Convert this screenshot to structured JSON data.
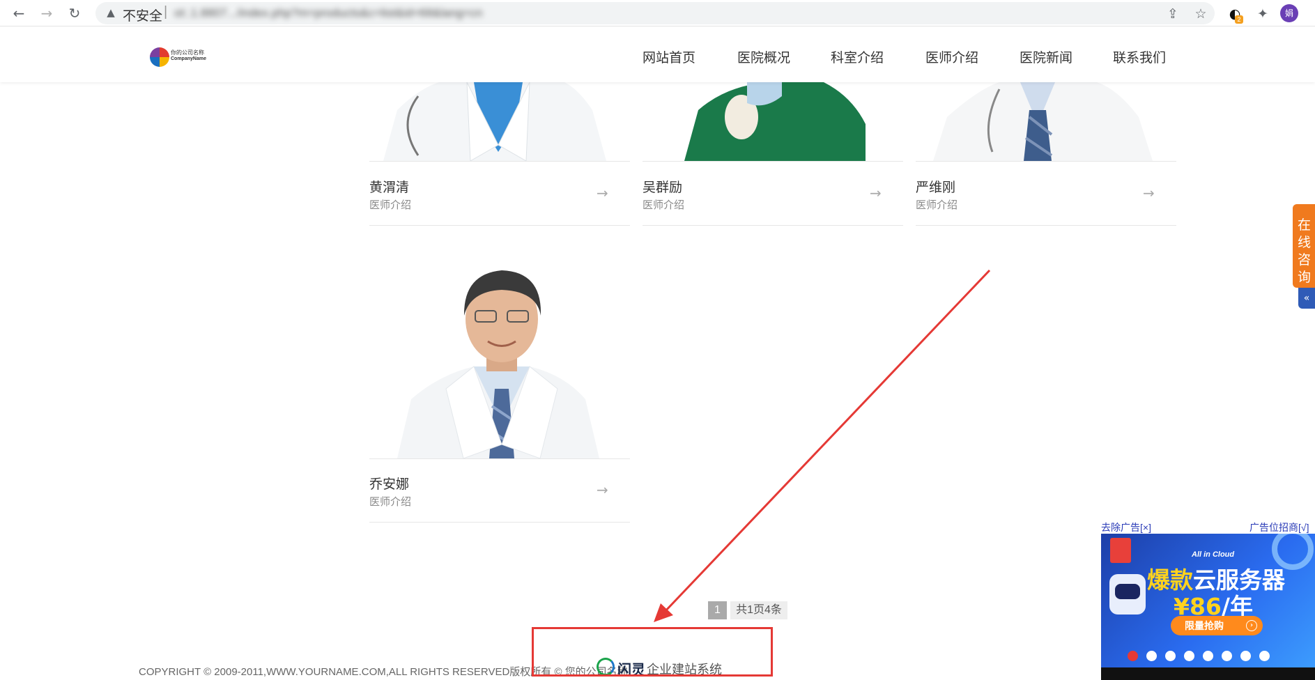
{
  "browser": {
    "security_label": "不安全",
    "url_blurred": "ot:.1.8807.../index.php?m=products&c=list&id=68&lang=cn",
    "ext_badge_count": "2",
    "profile_initial": "娟"
  },
  "header": {
    "logo_line1": "你的公司名称",
    "logo_line2": "CompanyName",
    "menu": [
      "网站首页",
      "医院概况",
      "科室介绍",
      "医师介绍",
      "医院新闻",
      "联系我们"
    ]
  },
  "doctors": [
    {
      "name": "黄渭清",
      "subtitle": "医师介绍"
    },
    {
      "name": "吴群励",
      "subtitle": "医师介绍"
    },
    {
      "name": "严维刚",
      "subtitle": "医师介绍"
    },
    {
      "name": "乔安娜",
      "subtitle": "医师介绍"
    }
  ],
  "pagination": {
    "current_page": "1",
    "summary": "共1页4条"
  },
  "footer": {
    "copyright": "COPYRIGHT © 2009-2011,WWW.YOURNAME.COM,ALL RIGHTS RESERVED版权所有 © 您的公司名称",
    "powered_brand": "闪灵",
    "powered_text": "企业建站系统"
  },
  "float_service": {
    "label": "在线咨询",
    "fold_icon": "«"
  },
  "ad": {
    "remove_label": "去除广告[×]",
    "recruit_label": "广告位招商[√]",
    "tagline": "All in Cloud",
    "title_highlight": "爆款",
    "title_rest": "云服务器",
    "price_highlight": "¥86",
    "price_rest": "/年",
    "button_label": "限量抢购",
    "slide_count": 8,
    "active_slide": 1
  },
  "colors": {
    "annotation_red": "#e53935",
    "service_orange": "#f07a1e",
    "ad_blue": "#2a6cf0"
  }
}
